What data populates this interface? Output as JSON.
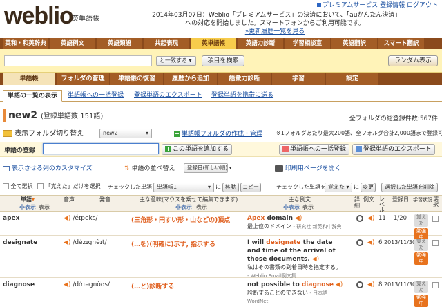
{
  "header": {
    "logo": "weblio",
    "logo_sub": "英単語帳",
    "premium_link": "プレミアムサービス",
    "register_link": "登録情報",
    "login_link": "ログアウト",
    "announce": "2014年03月07日：Weblio「プレミアムサービス」の決済において、「auかんたん決済」への対応を開始しました。スマートフォンからご利用可能です。",
    "announce_link": "»更新履歴一覧を見る"
  },
  "nav": [
    "英和・和英辞典",
    "英語例文",
    "英語類語",
    "共起表現",
    "英単語帳",
    "英語力診断",
    "学習相談室",
    "英語翻訳",
    "スマート翻訳"
  ],
  "search": {
    "select": "と一致する",
    "button": "項目を検索",
    "random": "ランダム表示"
  },
  "subnav": [
    "単語帳",
    "フォルダの管理",
    "単語帳の復習",
    "履歴から追加",
    "語彙力診断",
    "学習",
    "設定"
  ],
  "tabs": [
    "単語の一覧の表示",
    "単語帳への一括登録",
    "登録単語のエクスポート",
    "登録単語を携帯に送る"
  ],
  "title": {
    "name": "new2",
    "count": "(登録単語数:151語)",
    "total": "全フォルダの総登録件数:567件"
  },
  "folder": {
    "label": "表示フォルダ切り替え",
    "select": "new2",
    "create_link": "単語帳フォルダの作成・管理",
    "note": "※1フォルダあたり最大200語、全フォルダ合計2,000語まで登録可"
  },
  "register": {
    "label": "単語の登録",
    "add_button": "この単語を追加する",
    "bulk_button": "単語帳への一括登録",
    "export_button": "登録単語のエクスポート"
  },
  "display": {
    "customize": "表示させる列のカスタマイズ",
    "sort_label": "単語の並べ替え",
    "sort_select": "登録日(新しい順)",
    "print": "印刷用ページを開く"
  },
  "bulk": {
    "select_all": "全て選択",
    "only_learned": "「覚えた」だけを選択",
    "checked_label": "チェックした単語を",
    "folder_select": "単語帳1",
    "ni": "に",
    "move": "移動",
    "copy": "コピー",
    "checked_label2": "チェックした単語を",
    "state_select": "覚えた",
    "ni2": "に",
    "change": "変更",
    "delete": "選択した単語を削除"
  },
  "columns": {
    "word": "単語",
    "hidden": "非表示",
    "show": "表示",
    "pron": "音声",
    "pron2": "発音",
    "meaning": "主な意味(マウスを乗せて編集できます)",
    "example": "主な例文",
    "detail": "詳細",
    "ex": "例文",
    "level": "レベル",
    "date": "登録日",
    "status": "学習状況",
    "select": "選択"
  },
  "rows": [
    {
      "word": "apex",
      "pron": "/éɪpeks/",
      "meaning": "(三角形・円すい形・山などの)頂点",
      "ex_pre": "",
      "ex_hl": "Apex",
      "ex_post": " domain",
      "ex_jp": "最上位のドメイン",
      "ex_src": "- 研究社 新英和中辞典",
      "level": "11",
      "date": "1/20",
      "status1": "覚えた",
      "status2": "勉強中"
    },
    {
      "word": "designate",
      "pron": "/dézɪgnèɪt/",
      "meaning": "(…を)(明確に)示す, 指示する",
      "ex_pre": "I will ",
      "ex_hl": "designate",
      "ex_post": " the date and time of the arrival of those documents.",
      "ex_jp": "私はその書類の到着日時を指定する。",
      "ex_src": "- Weblio Email例文集",
      "level": "6",
      "date": "2013/11/30",
      "status1": "覚えた",
      "status2": "勉強中"
    },
    {
      "word": "diagnose",
      "pron": "/dάɪəgnòʊs/",
      "meaning": "(…と)診断する",
      "ex_pre": "not possible to ",
      "ex_hl": "diagnose",
      "ex_post": "",
      "ex_jp": "診断することのできない",
      "ex_src": "- 日本語WordNet",
      "level": "8",
      "date": "2013/11/30",
      "status1": "覚えた",
      "status2": "勉強中"
    }
  ]
}
